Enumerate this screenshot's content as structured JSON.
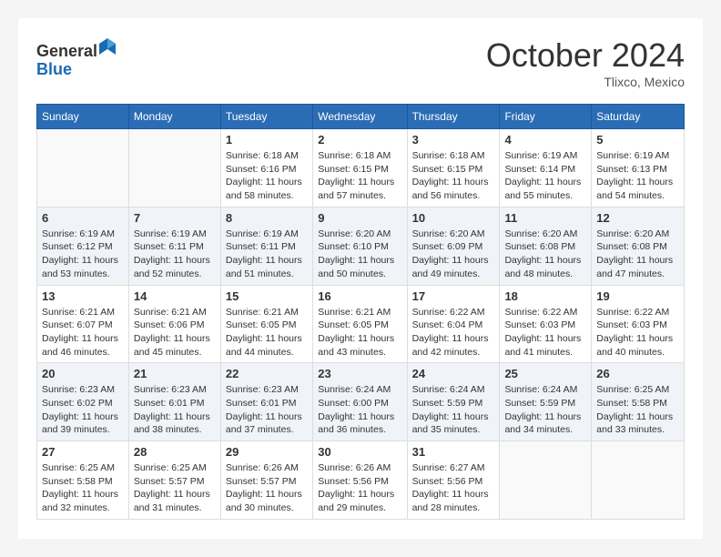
{
  "header": {
    "logo_line1": "General",
    "logo_line2": "Blue",
    "month_title": "October 2024",
    "location": "Tlixco, Mexico"
  },
  "weekdays": [
    "Sunday",
    "Monday",
    "Tuesday",
    "Wednesday",
    "Thursday",
    "Friday",
    "Saturday"
  ],
  "weeks": [
    [
      {
        "day": "",
        "info": ""
      },
      {
        "day": "",
        "info": ""
      },
      {
        "day": "1",
        "info": "Sunrise: 6:18 AM\nSunset: 6:16 PM\nDaylight: 11 hours and 58 minutes."
      },
      {
        "day": "2",
        "info": "Sunrise: 6:18 AM\nSunset: 6:15 PM\nDaylight: 11 hours and 57 minutes."
      },
      {
        "day": "3",
        "info": "Sunrise: 6:18 AM\nSunset: 6:15 PM\nDaylight: 11 hours and 56 minutes."
      },
      {
        "day": "4",
        "info": "Sunrise: 6:19 AM\nSunset: 6:14 PM\nDaylight: 11 hours and 55 minutes."
      },
      {
        "day": "5",
        "info": "Sunrise: 6:19 AM\nSunset: 6:13 PM\nDaylight: 11 hours and 54 minutes."
      }
    ],
    [
      {
        "day": "6",
        "info": "Sunrise: 6:19 AM\nSunset: 6:12 PM\nDaylight: 11 hours and 53 minutes."
      },
      {
        "day": "7",
        "info": "Sunrise: 6:19 AM\nSunset: 6:11 PM\nDaylight: 11 hours and 52 minutes."
      },
      {
        "day": "8",
        "info": "Sunrise: 6:19 AM\nSunset: 6:11 PM\nDaylight: 11 hours and 51 minutes."
      },
      {
        "day": "9",
        "info": "Sunrise: 6:20 AM\nSunset: 6:10 PM\nDaylight: 11 hours and 50 minutes."
      },
      {
        "day": "10",
        "info": "Sunrise: 6:20 AM\nSunset: 6:09 PM\nDaylight: 11 hours and 49 minutes."
      },
      {
        "day": "11",
        "info": "Sunrise: 6:20 AM\nSunset: 6:08 PM\nDaylight: 11 hours and 48 minutes."
      },
      {
        "day": "12",
        "info": "Sunrise: 6:20 AM\nSunset: 6:08 PM\nDaylight: 11 hours and 47 minutes."
      }
    ],
    [
      {
        "day": "13",
        "info": "Sunrise: 6:21 AM\nSunset: 6:07 PM\nDaylight: 11 hours and 46 minutes."
      },
      {
        "day": "14",
        "info": "Sunrise: 6:21 AM\nSunset: 6:06 PM\nDaylight: 11 hours and 45 minutes."
      },
      {
        "day": "15",
        "info": "Sunrise: 6:21 AM\nSunset: 6:05 PM\nDaylight: 11 hours and 44 minutes."
      },
      {
        "day": "16",
        "info": "Sunrise: 6:21 AM\nSunset: 6:05 PM\nDaylight: 11 hours and 43 minutes."
      },
      {
        "day": "17",
        "info": "Sunrise: 6:22 AM\nSunset: 6:04 PM\nDaylight: 11 hours and 42 minutes."
      },
      {
        "day": "18",
        "info": "Sunrise: 6:22 AM\nSunset: 6:03 PM\nDaylight: 11 hours and 41 minutes."
      },
      {
        "day": "19",
        "info": "Sunrise: 6:22 AM\nSunset: 6:03 PM\nDaylight: 11 hours and 40 minutes."
      }
    ],
    [
      {
        "day": "20",
        "info": "Sunrise: 6:23 AM\nSunset: 6:02 PM\nDaylight: 11 hours and 39 minutes."
      },
      {
        "day": "21",
        "info": "Sunrise: 6:23 AM\nSunset: 6:01 PM\nDaylight: 11 hours and 38 minutes."
      },
      {
        "day": "22",
        "info": "Sunrise: 6:23 AM\nSunset: 6:01 PM\nDaylight: 11 hours and 37 minutes."
      },
      {
        "day": "23",
        "info": "Sunrise: 6:24 AM\nSunset: 6:00 PM\nDaylight: 11 hours and 36 minutes."
      },
      {
        "day": "24",
        "info": "Sunrise: 6:24 AM\nSunset: 5:59 PM\nDaylight: 11 hours and 35 minutes."
      },
      {
        "day": "25",
        "info": "Sunrise: 6:24 AM\nSunset: 5:59 PM\nDaylight: 11 hours and 34 minutes."
      },
      {
        "day": "26",
        "info": "Sunrise: 6:25 AM\nSunset: 5:58 PM\nDaylight: 11 hours and 33 minutes."
      }
    ],
    [
      {
        "day": "27",
        "info": "Sunrise: 6:25 AM\nSunset: 5:58 PM\nDaylight: 11 hours and 32 minutes."
      },
      {
        "day": "28",
        "info": "Sunrise: 6:25 AM\nSunset: 5:57 PM\nDaylight: 11 hours and 31 minutes."
      },
      {
        "day": "29",
        "info": "Sunrise: 6:26 AM\nSunset: 5:57 PM\nDaylight: 11 hours and 30 minutes."
      },
      {
        "day": "30",
        "info": "Sunrise: 6:26 AM\nSunset: 5:56 PM\nDaylight: 11 hours and 29 minutes."
      },
      {
        "day": "31",
        "info": "Sunrise: 6:27 AM\nSunset: 5:56 PM\nDaylight: 11 hours and 28 minutes."
      },
      {
        "day": "",
        "info": ""
      },
      {
        "day": "",
        "info": ""
      }
    ]
  ]
}
